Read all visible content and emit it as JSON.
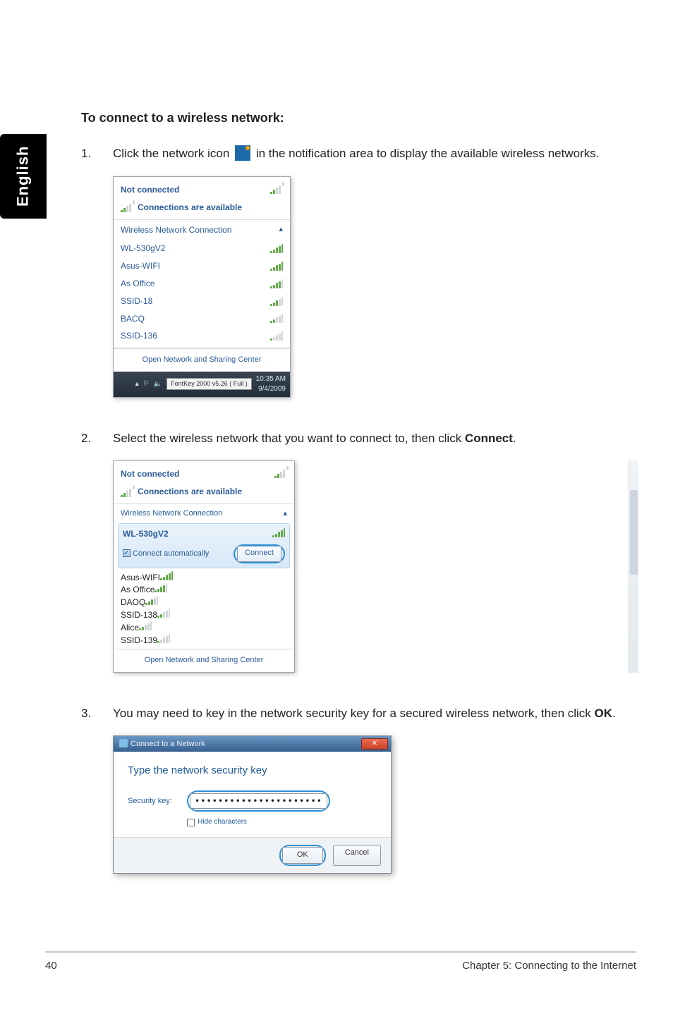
{
  "sideTab": "English",
  "heading": "To connect to a wireless network:",
  "step1": {
    "num": "1.",
    "pre": "Click the network icon",
    "post": "in the notification area to display the available wireless networks."
  },
  "shot1": {
    "status": "Not connected",
    "avail": "Connections are available",
    "category": "Wireless Network Connection",
    "nets": [
      "WL-530gV2",
      "Asus-WIFI",
      "As Office",
      "SSID-18",
      "BACQ",
      "SSID-136"
    ],
    "footerLink": "Open Network and Sharing Center",
    "trayTip": "FontKey 2000  v5.26 ( Full )",
    "trayTime": "10:35 AM",
    "trayDate": "9/4/2009"
  },
  "step2": {
    "num": "2.",
    "text_pre": "Select the wireless network that you want to connect to, then click ",
    "bold": "Connect",
    "text_post": "."
  },
  "shot2": {
    "status": "Not connected",
    "avail": "Connections are available",
    "category": "Wireless Network Connection",
    "selected_ssid": "WL-530gV2",
    "auto": "Connect automatically",
    "connect_btn": "Connect",
    "nets": [
      "Asus-WIFI",
      "As Office",
      "DAOQ",
      "SSID-138",
      "Alice",
      "SSID-139"
    ],
    "footerLink": "Open Network and Sharing Center"
  },
  "step3": {
    "num": "3.",
    "text_pre": "You may need to key in the network security key for a secured wireless network, then click ",
    "bold": "OK",
    "text_post": "."
  },
  "shot3": {
    "title": "Connect to a Network",
    "heading": "Type the network security key",
    "label": "Security key:",
    "mask": "••••••••••••••••••••••",
    "hide": "Hide characters",
    "ok": "OK",
    "cancel": "Cancel"
  },
  "footer": {
    "page": "40",
    "chapter": "Chapter 5: Connecting to the Internet"
  }
}
